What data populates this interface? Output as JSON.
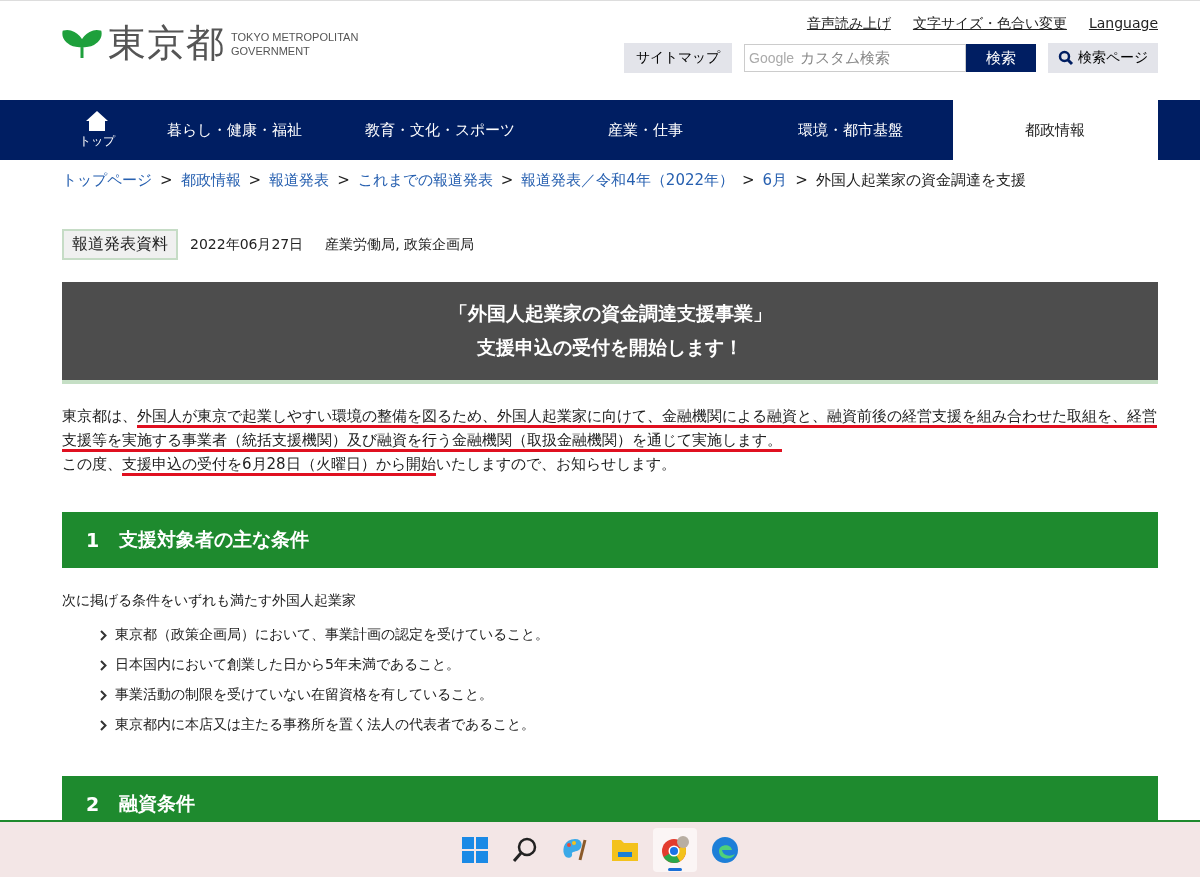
{
  "header": {
    "logo_text": "東京都",
    "logo_sub": [
      "TOKYO METROPOLITAN",
      "GOVERNMENT"
    ],
    "links": [
      "音声読み上げ",
      "文字サイズ・色合い変更",
      "Language"
    ],
    "sitemap": "サイトマップ",
    "search": {
      "placeholder": "カスタム検索",
      "brand": "Google",
      "button": "検索"
    },
    "search_page": "検索ページ"
  },
  "nav": [
    {
      "label": "トップ",
      "kind": "home",
      "selected": false
    },
    {
      "label": "暮らし・健康・福祉",
      "kind": "text",
      "selected": false
    },
    {
      "label": "教育・文化・スポーツ",
      "kind": "text",
      "selected": false
    },
    {
      "label": "産業・仕事",
      "kind": "text",
      "selected": false
    },
    {
      "label": "環境・都市基盤",
      "kind": "text",
      "selected": false
    },
    {
      "label": "都政情報",
      "kind": "text",
      "selected": true
    }
  ],
  "breadcrumb": [
    {
      "label": "トップページ",
      "link": true
    },
    {
      "separator": ">",
      "label": "都政情報",
      "link": true
    },
    {
      "separator": ">",
      "label": "報道発表",
      "link": true
    },
    {
      "separator": ">",
      "label": "これまでの報道発表",
      "link": true
    },
    {
      "separator": ">",
      "label": "報道発表／令和4年（2022年）",
      "link": true
    },
    {
      "separator": ">",
      "label": "6月",
      "link": true
    },
    {
      "separator": ">",
      "label": "外国人起業家の資金調達を支援",
      "link": false
    }
  ],
  "press": {
    "tag": "報道発表資料",
    "date": "2022年06月27日",
    "bureaus": "産業労働局, 政策企画局"
  },
  "title": [
    "「外国人起業家の資金調達支援事業」",
    "支援申込の受付を開始します！"
  ],
  "intro": [
    [
      {
        "text": "東京都は、",
        "underlined": false
      },
      {
        "text": "外国人が東京で起業しやすい環境の整備を図るため、外国人起業家に向けて、金融機関による融資と、融資前後の経営支援を組み合わせた取組を、経営支援等を実施する事業者（統括支援機関）及び融資を行う金融機関（取扱金融機関）を通じて実施します。",
        "underlined": true
      }
    ],
    [
      {
        "text": "この度、",
        "underlined": false
      },
      {
        "text": "支援申込の受付を6月28日（火曜日）から開始",
        "underlined": true
      },
      {
        "text": "いたしますので、お知らせします。",
        "underlined": false
      }
    ]
  ],
  "sections": [
    {
      "number": "1",
      "heading": "支援対象者の主な条件",
      "lead": "次に掲げる条件をいずれも満たす外国人起業家",
      "items": [
        "東京都（政策企画局）において、事業計画の認定を受けていること。",
        "日本国内において創業した日から5年未満であること。",
        "事業活動の制限を受けていない在留資格を有していること。",
        "東京都内に本店又は主たる事務所を置く法人の代表者であること。"
      ]
    },
    {
      "number": "2",
      "heading": "融資条件"
    }
  ],
  "taskbar": [
    {
      "kind": "start",
      "active": false
    },
    {
      "kind": "search",
      "active": false
    },
    {
      "kind": "paint",
      "active": false
    },
    {
      "kind": "folder",
      "active": false
    },
    {
      "kind": "chrome",
      "active": true
    },
    {
      "kind": "edge",
      "active": false
    }
  ]
}
